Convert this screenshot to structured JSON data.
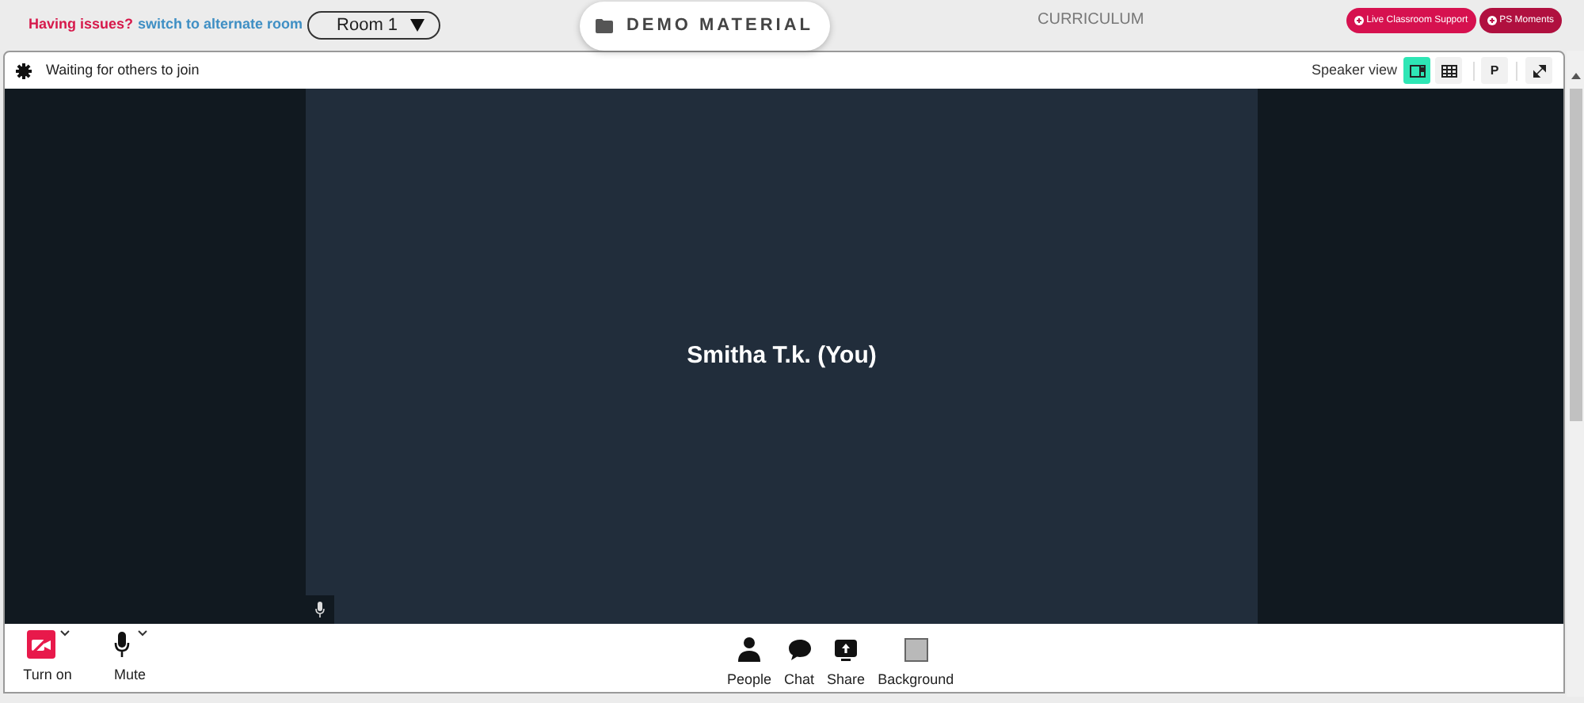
{
  "top_bar": {
    "issue_text": "Having issues?",
    "alternate_link": "switch to alternate room",
    "room_select": "Room 1",
    "demo_button": "DEMO MATERIAL",
    "curriculum_tab": "CURRICULUM",
    "support_buttons": [
      "Live Classroom Support",
      "PS Moments"
    ]
  },
  "meeting": {
    "status": "Waiting for others to join",
    "view_label": "Speaker view",
    "view_buttons": [
      {
        "kind": "speaker",
        "selected": true
      },
      {
        "kind": "grid",
        "selected": false
      }
    ],
    "presenter_button": "P",
    "participant": {
      "name": "Smitha T.k. (You)",
      "muted": false
    },
    "camera": {
      "label": "Turn on",
      "on": false
    },
    "mic": {
      "label": "Mute",
      "muted": false
    },
    "actions": [
      {
        "kind": "people",
        "label": "People"
      },
      {
        "kind": "chat",
        "label": "Chat"
      },
      {
        "kind": "share",
        "label": "Share"
      },
      {
        "kind": "background",
        "label": "Background"
      }
    ]
  }
}
